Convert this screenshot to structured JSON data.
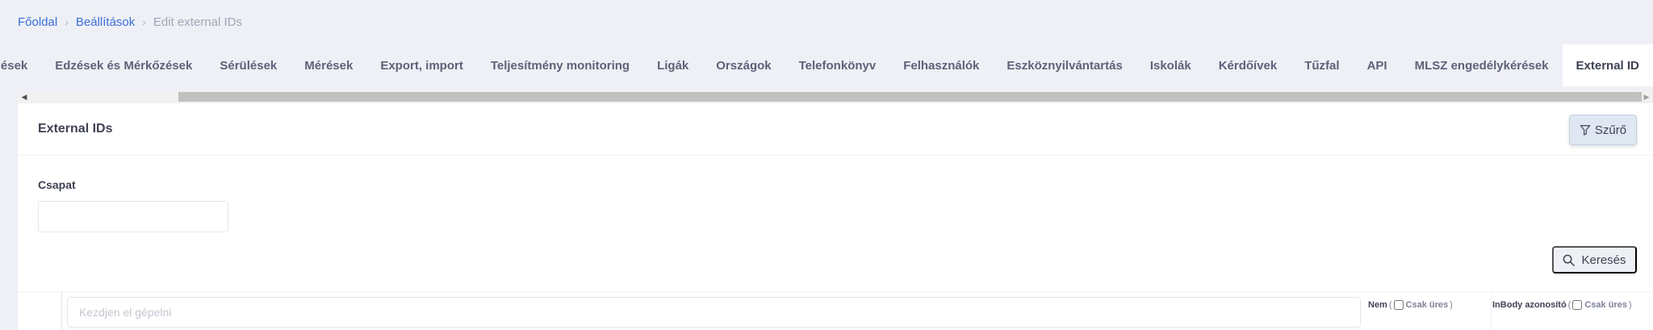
{
  "breadcrumb": {
    "home": "Főoldal",
    "settings": "Beállítások",
    "current": "Edit external IDs",
    "separator": "›"
  },
  "tabs": [
    {
      "label": "és Értékelések",
      "active": false
    },
    {
      "label": "Edzések és Mérkőzések",
      "active": false
    },
    {
      "label": "Sérülések",
      "active": false
    },
    {
      "label": "Mérések",
      "active": false
    },
    {
      "label": "Export, import",
      "active": false
    },
    {
      "label": "Teljesítmény monitoring",
      "active": false
    },
    {
      "label": "Ligák",
      "active": false
    },
    {
      "label": "Országok",
      "active": false
    },
    {
      "label": "Telefonkönyv",
      "active": false
    },
    {
      "label": "Felhasználók",
      "active": false
    },
    {
      "label": "Eszköznyilvántartás",
      "active": false
    },
    {
      "label": "Iskolák",
      "active": false
    },
    {
      "label": "Kérdőívek",
      "active": false
    },
    {
      "label": "Tűzfal",
      "active": false
    },
    {
      "label": "API",
      "active": false
    },
    {
      "label": "MLSZ engedélykérések",
      "active": false
    },
    {
      "label": "External ID",
      "active": true
    }
  ],
  "card": {
    "title": "External IDs",
    "filter_label": "Szűrő",
    "team_label": "Csapat",
    "team_value": "",
    "search_label": "Keresés"
  },
  "grid": {
    "filter_placeholder": "Kezdjen el gépelni",
    "columns": [
      {
        "title": "Nem",
        "empty_label": "Csak üres",
        "open": "(",
        "close": ")"
      },
      {
        "title": "InBody azonosító",
        "empty_label": "Csak üres",
        "open": "(",
        "close": ")"
      }
    ]
  },
  "icons": {
    "filter": "funnel-icon",
    "search": "magnifier-icon",
    "scroll_left": "triangle-left-icon",
    "scroll_right": "triangle-right-icon"
  },
  "colors": {
    "link": "#3a6fd8",
    "background": "#eef0f6",
    "text": "#3f4254",
    "muted": "#a1a5b7"
  }
}
